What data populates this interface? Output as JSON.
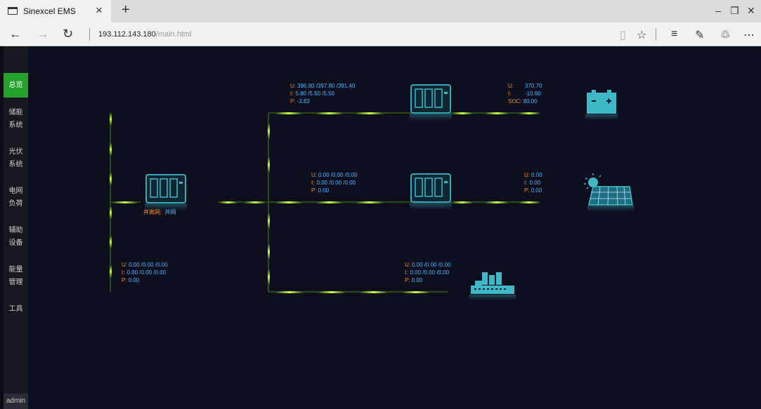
{
  "browser": {
    "tab_title": "Sinexcel EMS",
    "url_host": "193.112.143.180",
    "url_path": "/main.html"
  },
  "sidebar": {
    "items": [
      {
        "line1": "总览",
        "line2": ""
      },
      {
        "line1": "储能",
        "line2": "系统"
      },
      {
        "line1": "光伏",
        "line2": "系统"
      },
      {
        "line1": "电网",
        "line2": "负荷"
      },
      {
        "line1": "辅助",
        "line2": "设备"
      },
      {
        "line1": "能量",
        "line2": "管理"
      },
      {
        "line1": "工具",
        "line2": ""
      }
    ],
    "user": "admin"
  },
  "diagram": {
    "grid": {
      "u_label": "U:",
      "u_value": "0.00 /0.00 /0.00",
      "i_label": "I:",
      "i_value": "0.00 /0.00 /0.00",
      "p_label": "P:",
      "p_value": "0.00"
    },
    "main_inverter": {
      "mode_label": "并离网:",
      "mode_value": "并网"
    },
    "storage_pcs": {
      "u_label": "U:",
      "u_value": "396.80 /397.80 /391.40",
      "i_label": "I:",
      "i_value": "5.80 /5.50 /5.50",
      "p_label": "P:",
      "p_value": "-3.83"
    },
    "battery": {
      "u_label": "U:",
      "u_value": "370.70",
      "i_label": "I:",
      "i_value": "-10.90",
      "soc_label": "SOC:",
      "soc_value": "80.00"
    },
    "pv_pcs": {
      "u_label": "U:",
      "u_value": "0.00 /0.00 /0.00",
      "i_label": "I:",
      "i_value": "0.00 /0.00 /0.00",
      "p_label": "P:",
      "p_value": "0.00"
    },
    "pv_array": {
      "u_label": "U:",
      "u_value": "0.00",
      "i_label": "I:",
      "i_value": "0.00",
      "p_label": "P:",
      "p_value": "0.00"
    },
    "load": {
      "u_label": "U:",
      "u_value": "0.00 /0.00 /0.00",
      "i_label": "I:",
      "i_value": "0.00 /0.00 /0.00",
      "p_label": "P:",
      "p_value": "0.00"
    }
  },
  "colors": {
    "accent_green": "#22a12b",
    "line_glow": "#a6ff3a",
    "label_orange": "#ff8a1e",
    "value_blue": "#4ab8ff",
    "device_teal": "#3fb8c8"
  }
}
